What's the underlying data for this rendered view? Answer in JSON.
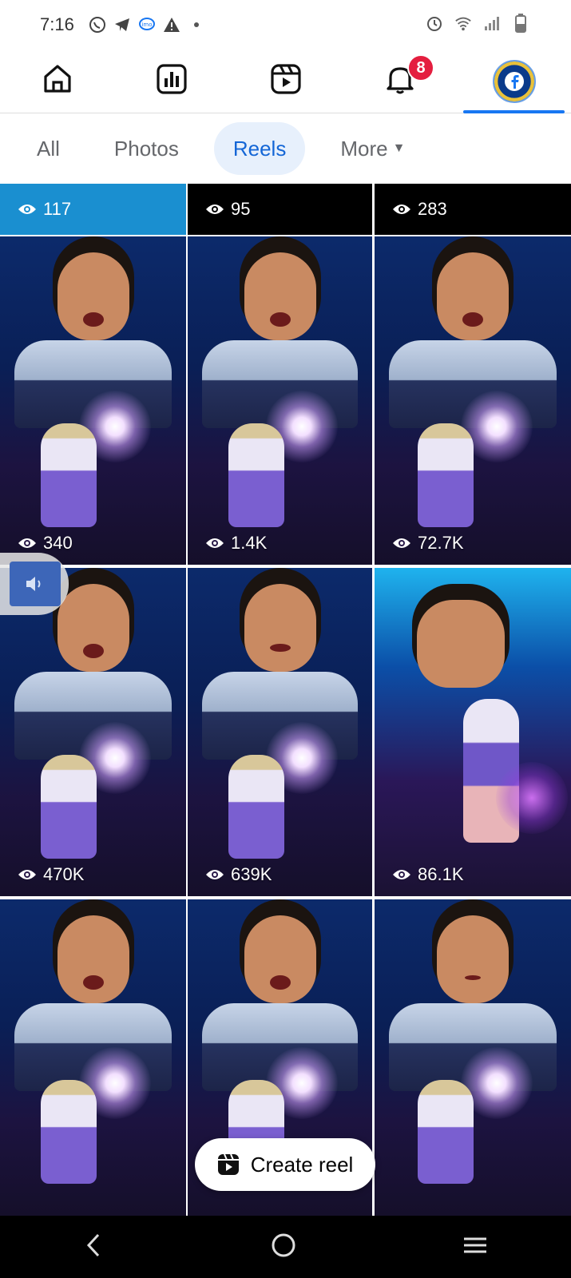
{
  "status_bar": {
    "time": "7:16",
    "left_icons": [
      "whatsapp-icon",
      "telegram-icon",
      "imo-icon",
      "warning-icon",
      "dot-icon"
    ],
    "right_icons": [
      "alarm-icon",
      "wifi-icon",
      "signal-icon",
      "battery-icon"
    ]
  },
  "top_nav": {
    "items": [
      {
        "name": "home",
        "icon": "home-icon"
      },
      {
        "name": "dashboard",
        "icon": "bar-chart-icon"
      },
      {
        "name": "reels",
        "icon": "video-icon"
      },
      {
        "name": "notifications",
        "icon": "bell-icon",
        "badge": "8"
      },
      {
        "name": "profile",
        "icon": "avatar",
        "active": true
      }
    ]
  },
  "filters": {
    "all": "All",
    "photos": "Photos",
    "reels": "Reels",
    "more": "More",
    "active": "Reels"
  },
  "strip": {
    "views": [
      "117",
      "95",
      "283"
    ]
  },
  "reels": [
    {
      "views": "340"
    },
    {
      "views": "1.4K"
    },
    {
      "views": "72.7K"
    },
    {
      "views": "470K"
    },
    {
      "views": "639K"
    },
    {
      "views": "86.1K"
    },
    {
      "views": ""
    },
    {
      "views": ""
    },
    {
      "views": ""
    }
  ],
  "create_reel": {
    "label": "Create reel"
  },
  "colors": {
    "accent": "#1877f2",
    "badge": "#e41e3f",
    "chip_active_bg": "#e7f0fc",
    "chip_active_text": "#1466d6"
  }
}
